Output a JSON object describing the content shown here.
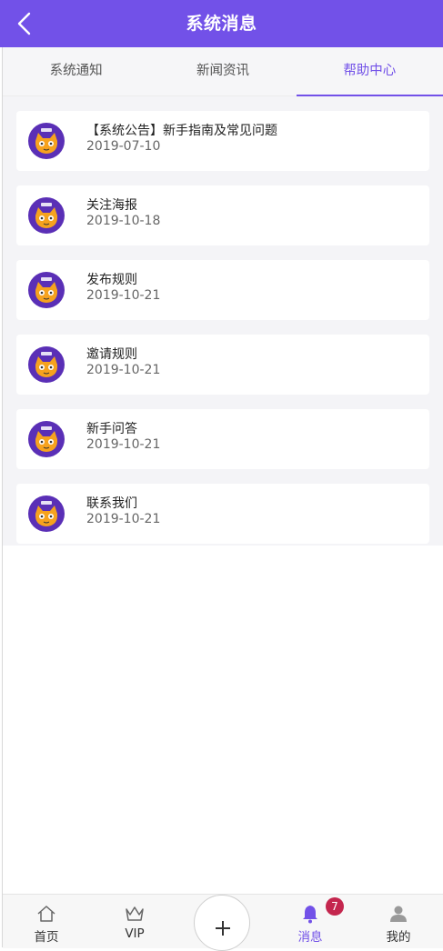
{
  "header": {
    "title": "系统消息"
  },
  "tabs": [
    {
      "label": "系统通知"
    },
    {
      "label": "新闻资讯"
    },
    {
      "label": "帮助中心"
    }
  ],
  "active_tab": "帮助中心",
  "messages": [
    {
      "title": "【系统公告】新手指南及常见问题",
      "date": "2019-07-10"
    },
    {
      "title": "关注海报",
      "date": "2019-10-18"
    },
    {
      "title": "发布规则",
      "date": "2019-10-21"
    },
    {
      "title": "邀请规则",
      "date": "2019-10-21"
    },
    {
      "title": "新手问答",
      "date": "2019-10-21"
    },
    {
      "title": "联系我们",
      "date": "2019-10-21"
    }
  ],
  "bottom_nav": {
    "home": "首页",
    "vip": "VIP",
    "messages": "消息",
    "messages_badge": "7",
    "mine": "我的"
  },
  "colors": {
    "accent": "#7251e8",
    "badge": "#c4264e"
  }
}
